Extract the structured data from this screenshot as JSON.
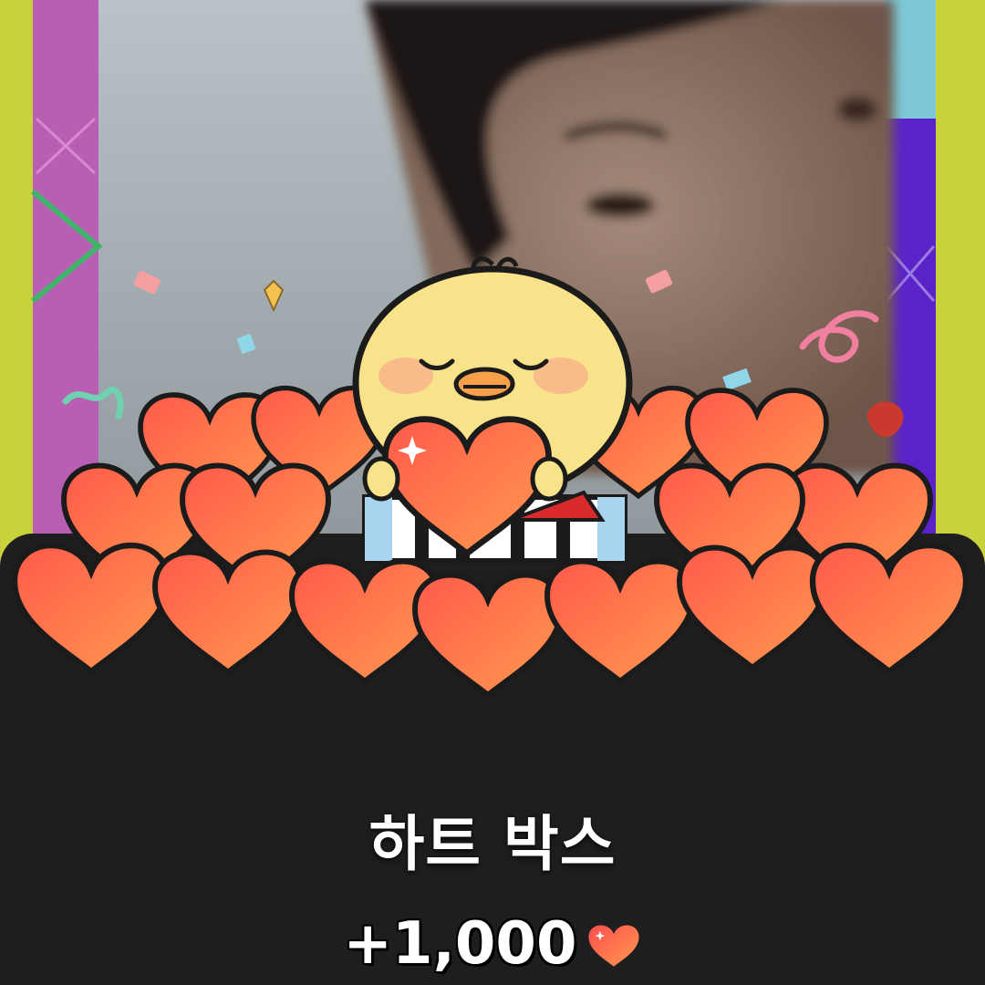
{
  "gift": {
    "name": "하트 박스",
    "reward_amount": "+1,000",
    "reward_icon": "heart-icon"
  },
  "colors": {
    "panel": "#1e1e1e",
    "heart_top": "#ff6b5a",
    "heart_bottom": "#ff8a4c",
    "chick": "#f8e28a",
    "text": "#ffffff"
  }
}
